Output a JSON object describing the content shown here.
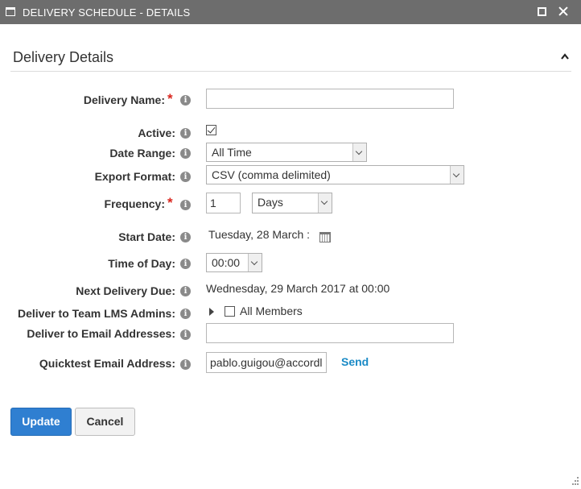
{
  "window": {
    "title": "DELIVERY SCHEDULE - DETAILS"
  },
  "section": {
    "title": "Delivery Details"
  },
  "fields": {
    "delivery_name": {
      "label": "Delivery Name:",
      "value": "",
      "required": "*"
    },
    "active": {
      "label": "Active:",
      "checked": true
    },
    "date_range": {
      "label": "Date Range:",
      "value": "All Time"
    },
    "export_format": {
      "label": "Export Format:",
      "value": "CSV (comma delimited)"
    },
    "frequency": {
      "label": "Frequency:",
      "required": "*",
      "count": "1",
      "unit": "Days"
    },
    "start_date": {
      "label": "Start Date:",
      "value": "Tuesday, 28 March :"
    },
    "time_of_day": {
      "label": "Time of Day:",
      "value": "00:00"
    },
    "next_delivery": {
      "label": "Next Delivery Due:",
      "value": "Wednesday, 29 March 2017 at 00:00"
    },
    "team_admins": {
      "label": "Deliver to Team LMS Admins:",
      "option": "All Members",
      "checked": false
    },
    "email_addresses": {
      "label": "Deliver to Email Addresses:",
      "value": ""
    },
    "quicktest": {
      "label": "Quicktest Email Address:",
      "value": "pablo.guigou@accordl",
      "send_label": "Send"
    }
  },
  "info_glyph": "i",
  "buttons": {
    "update": "Update",
    "cancel": "Cancel"
  },
  "colors": {
    "titlebar": "#6d6d6d",
    "primary": "#2f7fd1",
    "required": "#d9251d",
    "link": "#1a8ac6"
  },
  "icons": [
    "window-icon",
    "maximize-icon",
    "close-icon",
    "collapse-chevron-icon",
    "info-icon",
    "calendar-icon",
    "expand-arrow-icon",
    "resize-grip-icon"
  ]
}
